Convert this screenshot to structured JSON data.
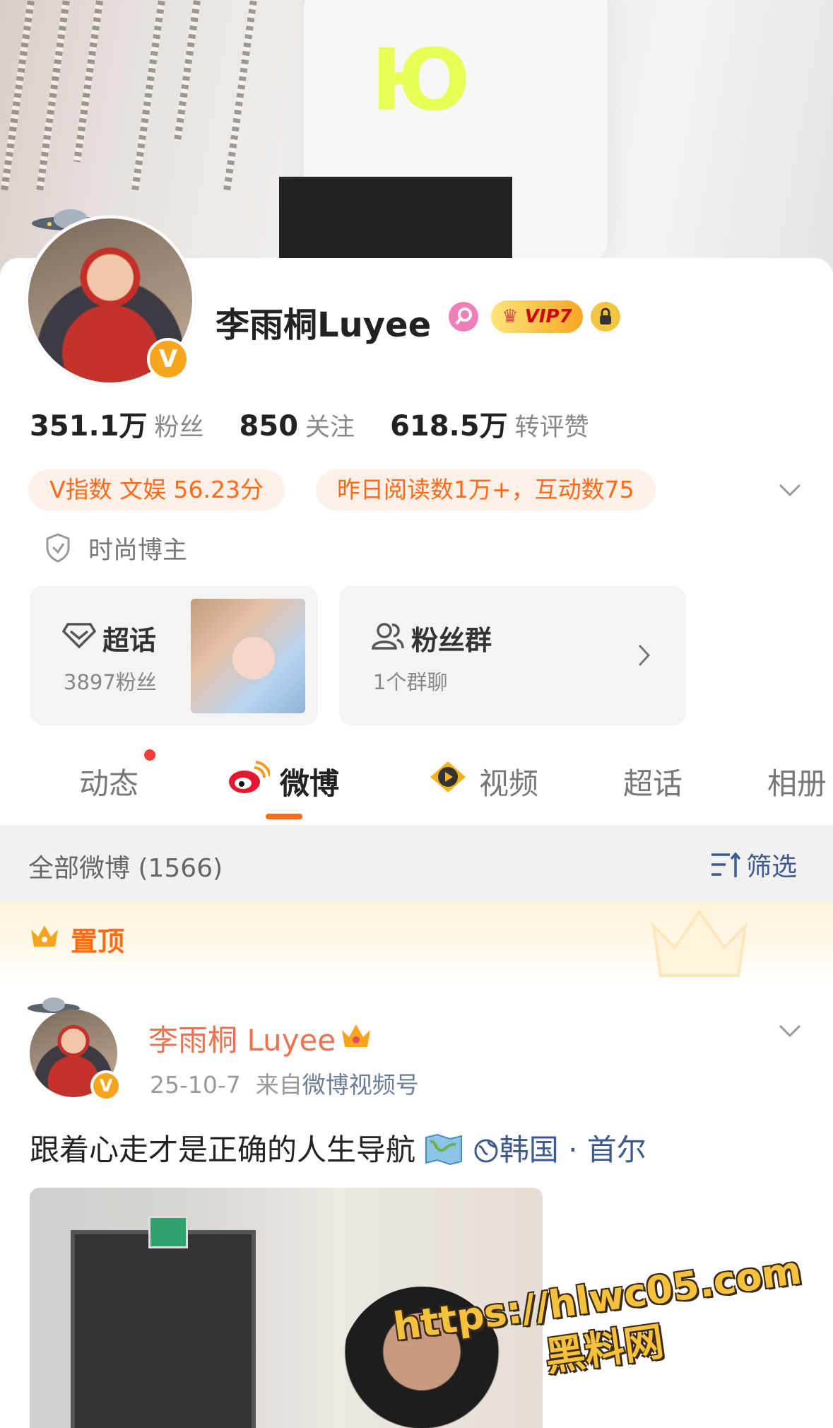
{
  "cover": {
    "shirt_text": "Ю"
  },
  "profile": {
    "name": "李雨桐Luyee",
    "vip_label": "VIP7",
    "verified_badge": "V",
    "stats": [
      {
        "num": "351.1万",
        "label": "粉丝"
      },
      {
        "num": "850",
        "label": "关注"
      },
      {
        "num": "618.5万",
        "label": "转评赞"
      }
    ],
    "pills": [
      "V指数 文娱 56.23分",
      "昨日阅读数1万+，互动数75"
    ],
    "category": "时尚博主",
    "tiles": {
      "super_topic": {
        "title": "超话",
        "sub": "3897粉丝"
      },
      "fan_group": {
        "title": "粉丝群",
        "sub": "1个群聊"
      }
    }
  },
  "tabs": [
    {
      "label": "动态"
    },
    {
      "label": "微博"
    },
    {
      "label": "视频"
    },
    {
      "label": "超话"
    },
    {
      "label": "相册"
    }
  ],
  "filter": {
    "all_label": "全部微博 (1566)",
    "filter_label": "筛选"
  },
  "pinned": {
    "label": "置顶"
  },
  "post": {
    "author": "李雨桐 Luyee",
    "date": "25-10-7",
    "source_prefix": "来自",
    "source_link": "微博视频号",
    "text": "跟着心走才是正确的人生导航",
    "location": "韩国 · 首尔"
  },
  "watermark": {
    "line1": "https://hlwc05.com",
    "line2": "黑料网"
  },
  "colors": {
    "accent": "#ff6a17",
    "link": "#eb7350",
    "badge": "#f7a51d"
  }
}
